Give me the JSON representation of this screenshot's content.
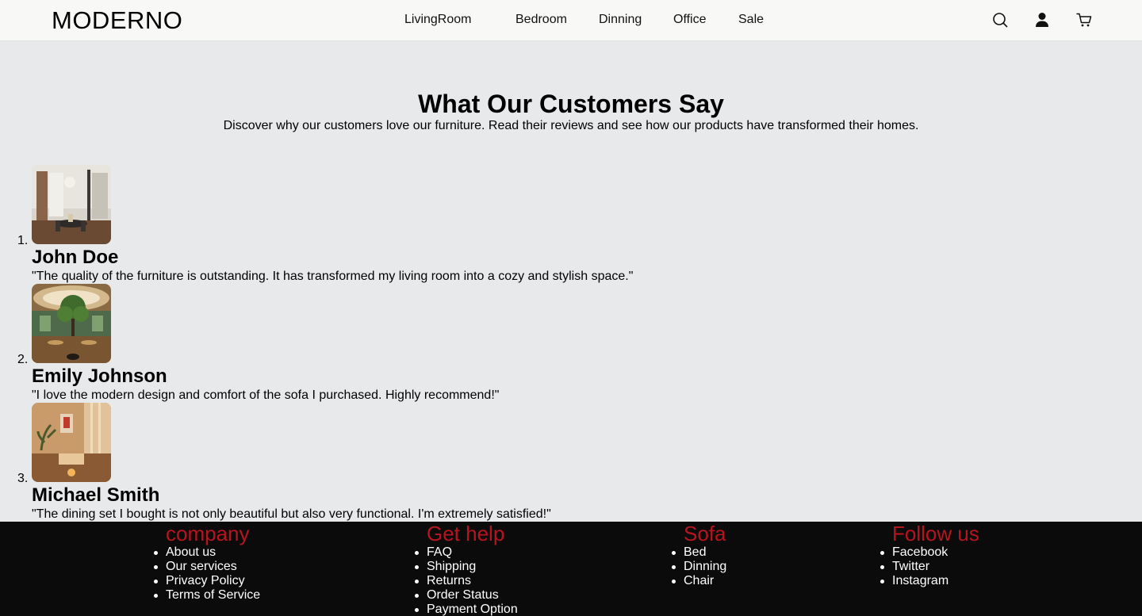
{
  "header": {
    "logo": "MODERNO",
    "nav": [
      "LivingRoom",
      "Bedroom",
      "Dinning",
      "Office",
      "Sale"
    ],
    "icons": {
      "search": "search-icon",
      "account": "user-icon",
      "cart": "cart-icon"
    }
  },
  "intro": {
    "title": "What Our Customers Say",
    "subtitle": "Discover why our customers love our furniture. Read their reviews and see how our products have transformed their homes."
  },
  "reviews": [
    {
      "number": "1.",
      "name": "John Doe",
      "quote": "\"The quality of the furniture is outstanding. It has transformed my living room into a cozy and stylish space.\""
    },
    {
      "number": "2.",
      "name": "Emily Johnson",
      "quote": "\"I love the modern design and comfort of the sofa I purchased. Highly recommend!\""
    },
    {
      "number": "3.",
      "name": "Michael Smith",
      "quote": "\"The dining set I bought is not only beautiful but also very functional. I'm extremely satisfied!\""
    }
  ],
  "footer": {
    "columns": [
      {
        "heading": "company",
        "links": [
          "About us",
          "Our services",
          "Privacy Policy",
          "Terms of Service"
        ]
      },
      {
        "heading": "Get help",
        "links": [
          "FAQ",
          "Shipping",
          "Returns",
          "Order Status",
          "Payment Option"
        ]
      },
      {
        "heading": "Sofa",
        "links": [
          "Bed",
          "Dinning",
          "Chair"
        ]
      },
      {
        "heading": "Follow us",
        "links": [
          "Facebook",
          "Twitter",
          "Instagram"
        ]
      }
    ]
  },
  "colors": {
    "footer_heading": "#b8141f",
    "footer_bg": "#0b0b0b",
    "page_bg": "#e8e9eb",
    "header_bg": "#f8f8f7"
  }
}
